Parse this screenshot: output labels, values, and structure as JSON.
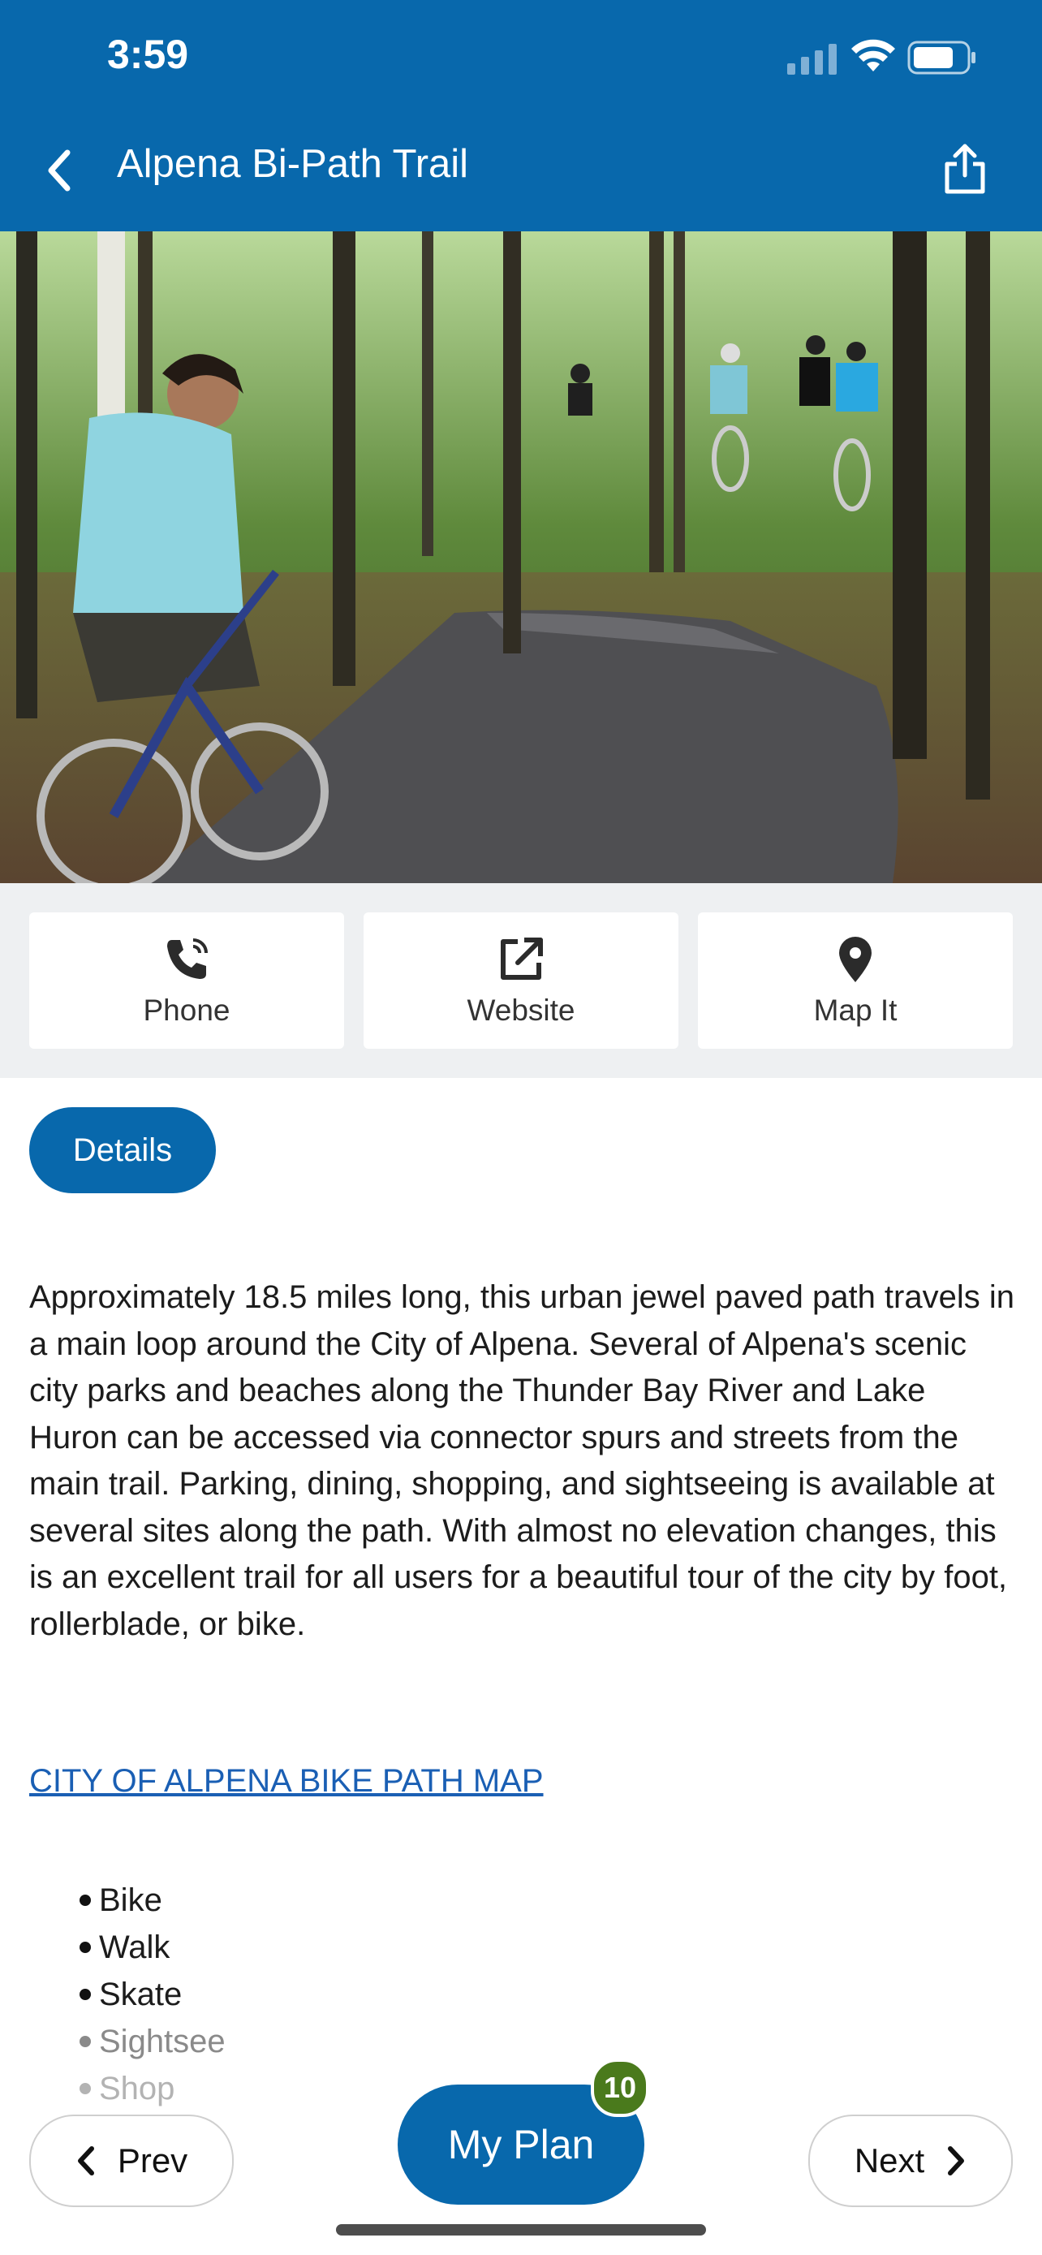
{
  "status_bar": {
    "time": "3:59"
  },
  "nav": {
    "title": "Alpena Bi-Path Trail"
  },
  "actions": [
    {
      "label": "Phone",
      "icon": "phone-icon"
    },
    {
      "label": "Website",
      "icon": "external-link-icon"
    },
    {
      "label": "Map It",
      "icon": "map-pin-icon"
    }
  ],
  "tab": {
    "label": "Details"
  },
  "description": "Approximately 18.5 miles long, this urban jewel paved path travels in a main loop around the City of Alpena. Several of Alpena's scenic city parks and beaches along the Thunder Bay River and Lake Huron can be accessed via connector spurs and streets from the main trail. Parking, dining, shopping, and sightseeing is available at several sites along the path. With almost no elevation changes, this is an excellent trail for all users for a beautiful tour of the city by foot, rollerblade, or bike.",
  "map_link": "CITY OF ALPENA BIKE PATH MAP",
  "activities": [
    "Bike",
    "Walk",
    "Skate",
    "Sightsee",
    "Shop"
  ],
  "footer": {
    "prev": "Prev",
    "next": "Next",
    "my_plan": "My Plan",
    "plan_count": "10"
  },
  "colors": {
    "brand_blue": "#0868ac",
    "badge_green": "#4a7a1c",
    "link": "#1a5fb4"
  }
}
